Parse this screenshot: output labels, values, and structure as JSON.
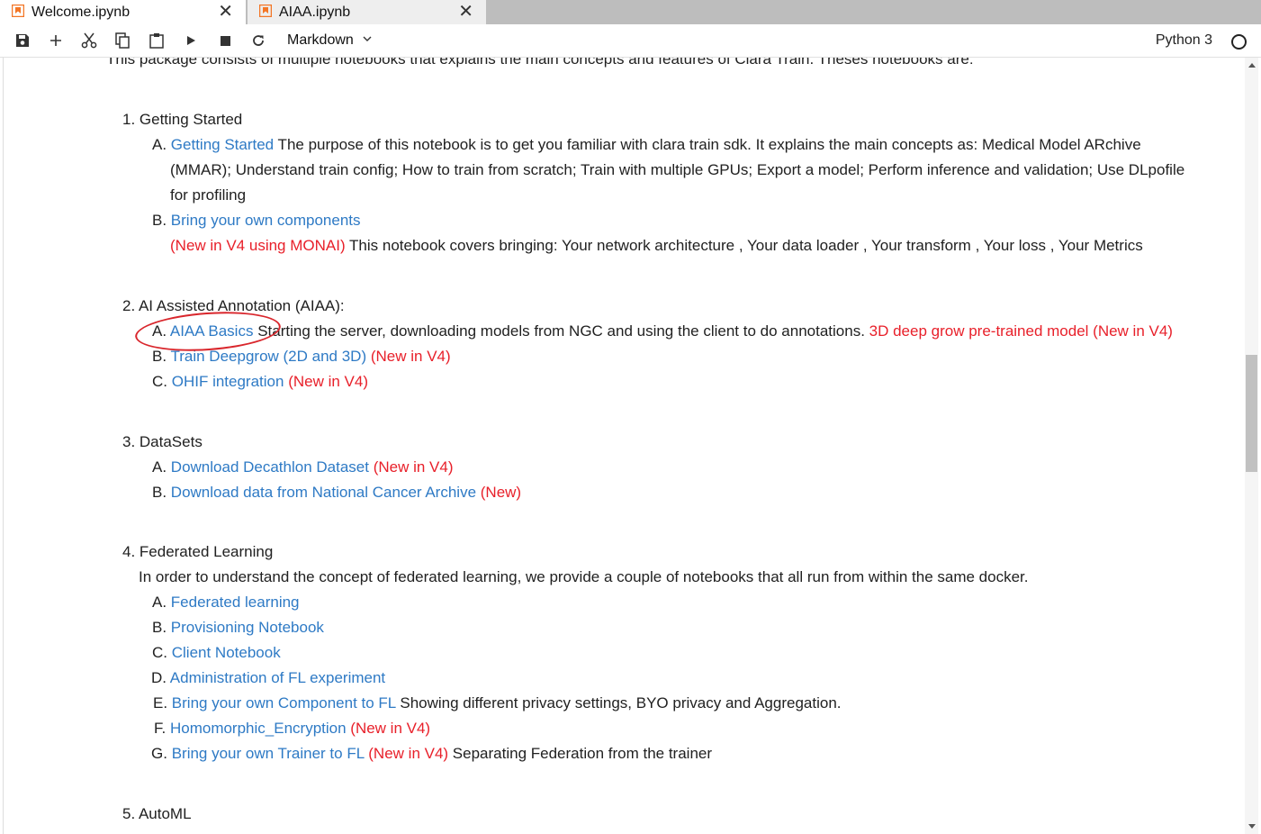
{
  "tabs": [
    {
      "label": "Welcome.ipynb",
      "active": true
    },
    {
      "label": "AIAA.ipynb",
      "active": false
    }
  ],
  "toolbar": {
    "cell_type": "Markdown",
    "kernel": "Python 3",
    "icons": [
      "save-icon",
      "add-icon",
      "cut-icon",
      "copy-icon",
      "paste-icon",
      "run-icon",
      "stop-icon",
      "restart-icon"
    ]
  },
  "colors": {
    "link": "#2e7ac5",
    "new": "#e8202a",
    "annotation": "#d9262c"
  },
  "content": {
    "intro": "This package consists of multiple notebooks that explains the main concepts and features of Clara Train. Theses notebooks are:",
    "s1": {
      "title": "1. Getting Started",
      "a_mark": "A.",
      "a_link": "Getting Started",
      "a_text1": " The purpose of this notebook is to get you familiar with clara train sdk. It explains the main concepts as: Medical Model ARchive",
      "a_text2": "(MMAR); Understand train config; How to train from scratch; Train with multiple GPUs; Export a model; Perform inference and validation; Use DLpofile",
      "a_text3": "for profiling",
      "b_mark": "B.",
      "b_link": "Bring your own components",
      "b_new": "(New in V4 using MONAI)",
      "b_text": " This notebook covers bringing: Your network architecture , Your data loader , Your transform , Your loss , Your Metrics"
    },
    "s2": {
      "title": "2. AI Assisted Annotation (AIAA):",
      "a_mark": "A.",
      "a_link": "AIAA Basics",
      "a_text": " Starting the server, downloading models from NGC and using the client to do annotations. ",
      "a_new": "3D deep grow pre-trained model (New in V4)",
      "b_mark": "B.",
      "b_link": "Train Deepgrow (2D and 3D)",
      "b_new": " (New in V4)",
      "c_mark": "C.",
      "c_link": "OHIF integration",
      "c_new": " (New in V4)"
    },
    "s3": {
      "title": "3. DataSets",
      "a_mark": "A.",
      "a_link": "Download Decathlon Dataset",
      "a_new": " (New in V4)",
      "b_mark": "B.",
      "b_link": "Download data from National Cancer Archive",
      "b_new": " (New)"
    },
    "s4": {
      "title": "4. Federated Learning",
      "desc": "In order to understand the concept of federated learning, we provide a couple of notebooks that all run from within the same docker.",
      "a_mark": "A.",
      "a_link": "Federated learning",
      "b_mark": "B.",
      "b_link": "Provisioning Notebook",
      "c_mark": "C.",
      "c_link": "Client Notebook",
      "d_mark": "D.",
      "d_link": "Administration of FL experiment",
      "e_mark": "E.",
      "e_link": "Bring your own Component to FL",
      "e_text": " Showing different privacy settings, BYO privacy and Aggregation.",
      "f_mark": "F.",
      "f_link": "Homomorphic_Encryption",
      "f_new": " (New in V4)",
      "g_mark": "G.",
      "g_link": "Bring your own Trainer to FL",
      "g_new": " (New in V4)",
      "g_text": " Separating Federation from the trainer"
    },
    "s5": {
      "title": "5. AutoML"
    }
  }
}
